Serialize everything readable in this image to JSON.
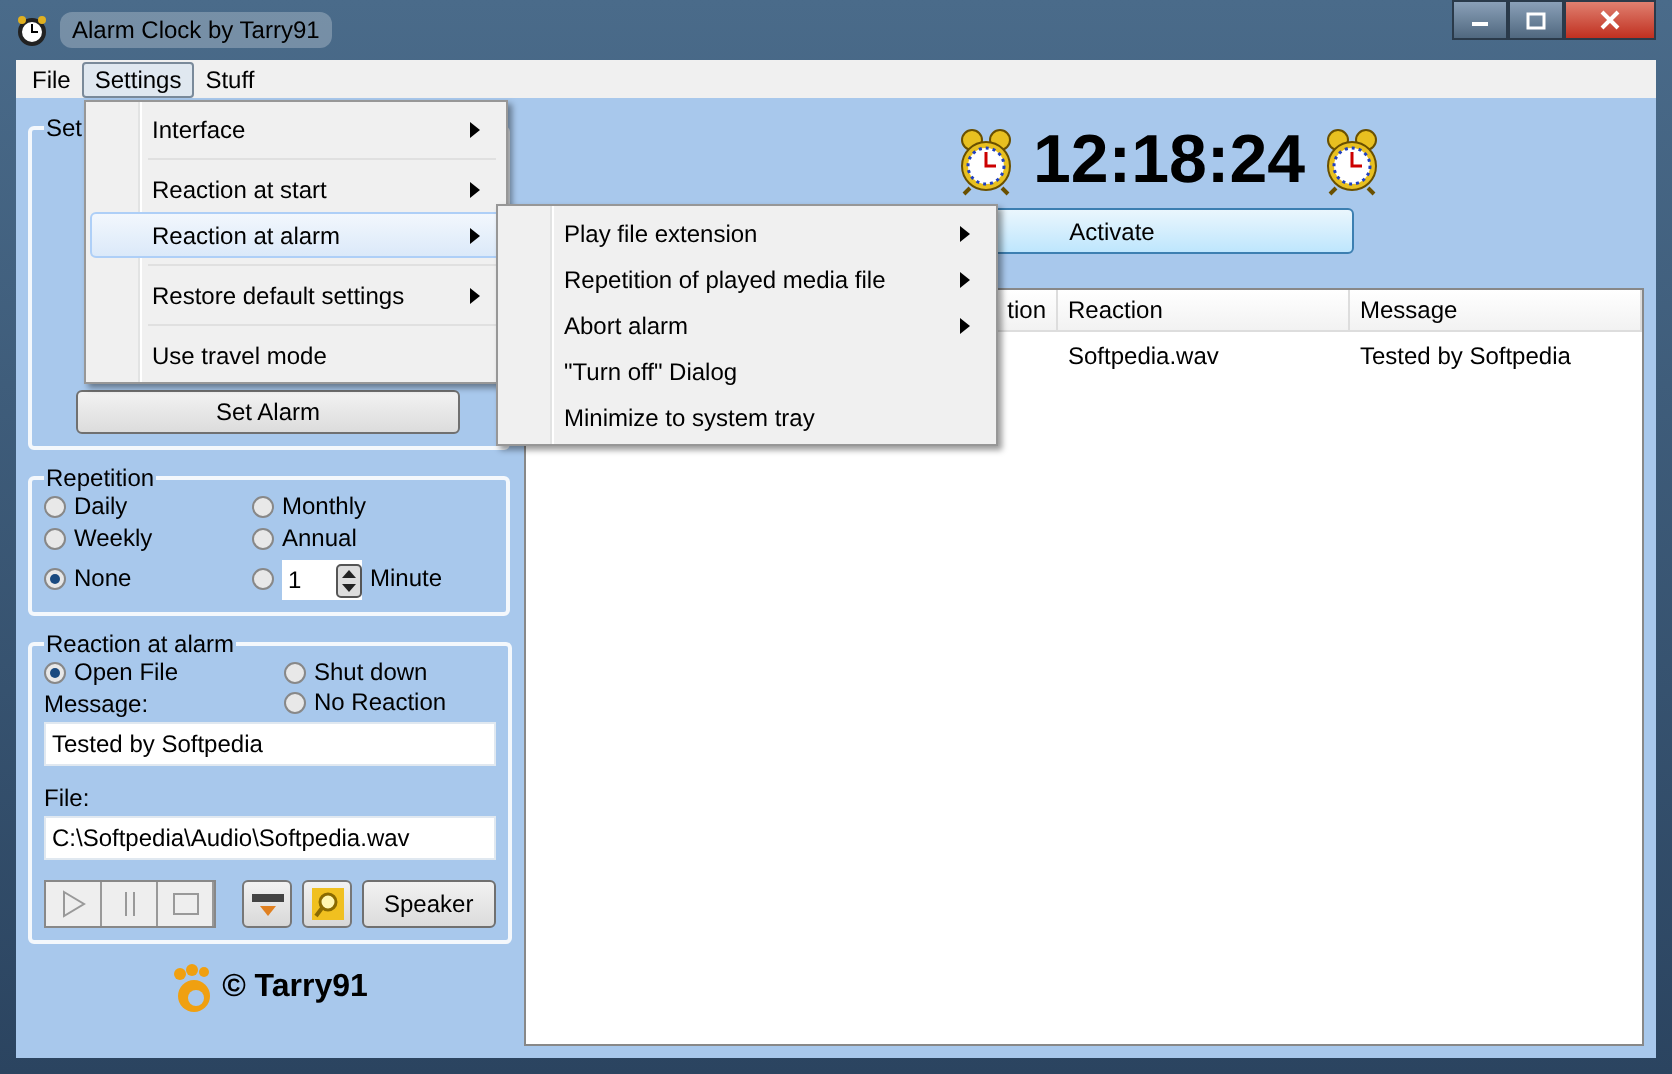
{
  "window": {
    "title": "Alarm Clock by Tarry91"
  },
  "menu_bar": [
    {
      "label": "File",
      "selected": false
    },
    {
      "label": "Settings",
      "selected": true
    },
    {
      "label": "Stuff",
      "selected": false
    }
  ],
  "settings_menu": [
    {
      "label": "Interface",
      "submenu": true,
      "highlighted": false,
      "separator_after": true
    },
    {
      "label": "Reaction at start",
      "submenu": true,
      "highlighted": false,
      "separator_after": false
    },
    {
      "label": "Reaction at alarm",
      "submenu": true,
      "highlighted": true,
      "separator_after": true
    },
    {
      "label": "Restore default settings",
      "submenu": true,
      "highlighted": false,
      "separator_after": true
    },
    {
      "label": "Use travel mode",
      "submenu": false,
      "highlighted": false
    }
  ],
  "alarm_submenu": [
    {
      "label": "Play file extension",
      "submenu": true
    },
    {
      "label": "Repetition of played media file",
      "submenu": true
    },
    {
      "label": "Abort alarm",
      "submenu": true
    },
    {
      "label": "\"Turn off\" Dialog",
      "submenu": false
    },
    {
      "label": "Minimize to system tray",
      "submenu": false
    }
  ],
  "set_group": {
    "title": "Set",
    "button": "Set Alarm"
  },
  "repetition": {
    "title": "Repetition",
    "options": [
      {
        "kind": "plain",
        "label": "Daily",
        "selected": false
      },
      {
        "kind": "plain",
        "label": "Monthly",
        "selected": false
      },
      {
        "kind": "plain",
        "label": "Weekly",
        "selected": false
      },
      {
        "kind": "plain",
        "label": "Annual",
        "selected": false
      },
      {
        "kind": "plain",
        "label": "None",
        "selected": true
      },
      {
        "kind": "interval",
        "value": "1",
        "label": "Minute",
        "selected": false
      }
    ]
  },
  "reaction": {
    "title": "Reaction at alarm",
    "options": [
      {
        "label": "Open File",
        "selected": true
      },
      {
        "label": "Shut down",
        "selected": false
      },
      {
        "label": "No Reaction",
        "selected": false
      }
    ],
    "message_label": "Message:",
    "message": "Tested by Softpedia",
    "file_label": "File:",
    "file": "C:\\Softpedia\\Audio\\Softpedia.wav",
    "speaker_button": "Speaker"
  },
  "footer": {
    "copyright": "© Tarry91"
  },
  "clock": {
    "time": "12:18:24",
    "button": "Activate"
  },
  "table": {
    "columns": [
      "tion",
      "Reaction",
      "Message"
    ],
    "rows": [
      {
        "reaction": "Softpedia.wav",
        "message": "Tested by Softpedia"
      }
    ]
  }
}
